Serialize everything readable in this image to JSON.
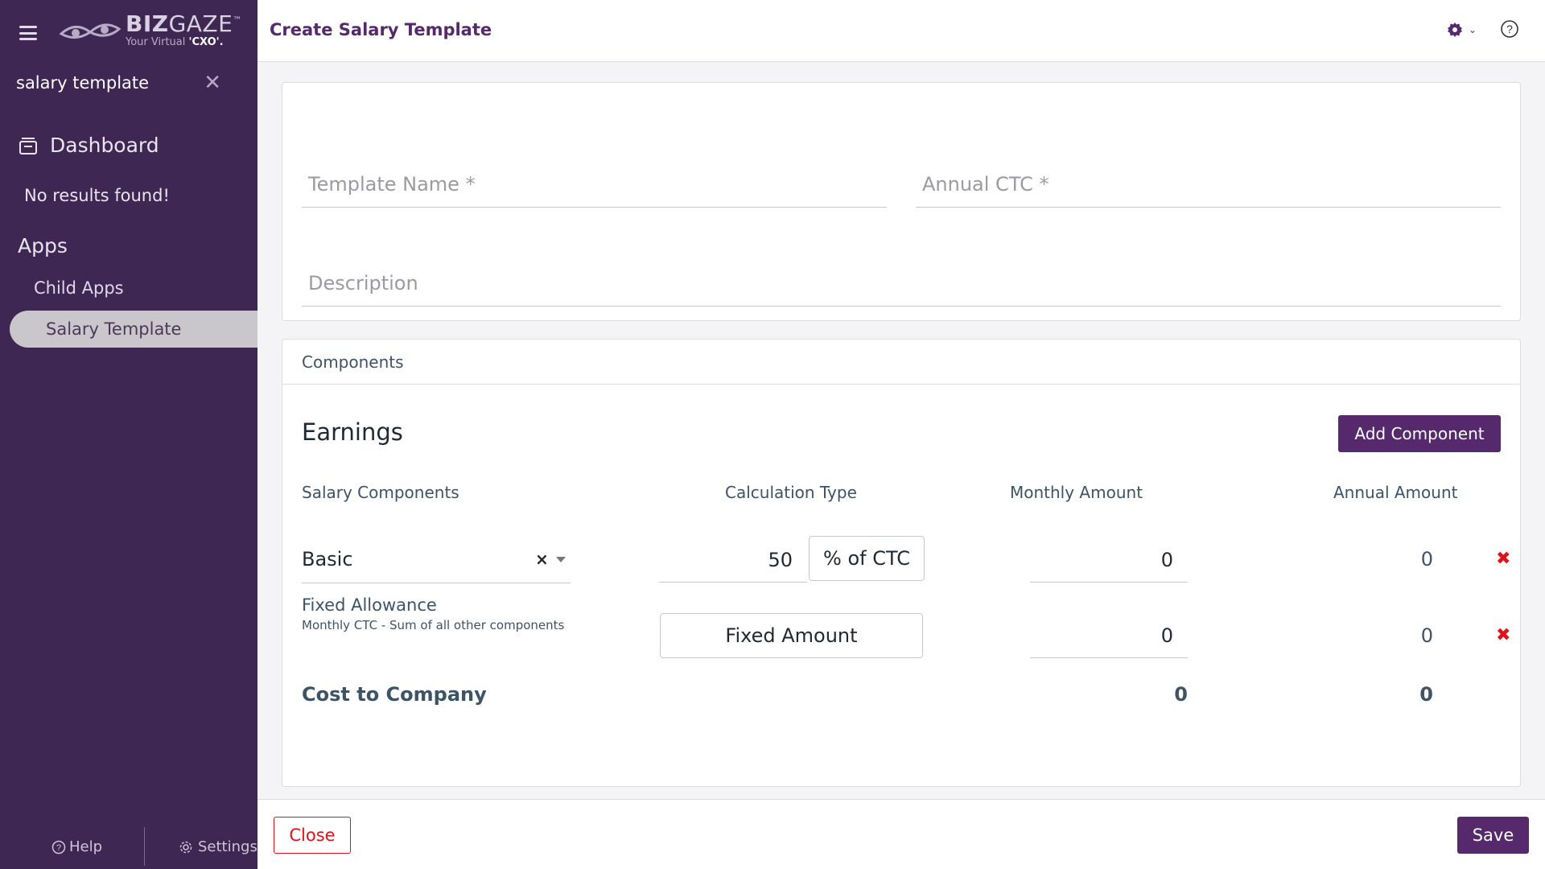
{
  "sidebar": {
    "logo": {
      "brand": "BIZGAZE",
      "brand_bold": "BIZ",
      "brand_light": "GAZE",
      "trademark": "™",
      "tagline_prefix": "Your Virtual ",
      "tagline_bold": "'CXO'."
    },
    "search": {
      "value": "salary template",
      "clear": "✕"
    },
    "dashboard_label": "Dashboard",
    "no_results": "No results found!",
    "apps_label": "Apps",
    "child_apps_label": "Child Apps",
    "active_item": "Salary Template",
    "footer": {
      "help": "Help",
      "settings": "Settings"
    }
  },
  "header": {
    "title": "Create Salary Template"
  },
  "form": {
    "template_name_placeholder": "Template Name *",
    "annual_ctc_placeholder": "Annual CTC *",
    "description_placeholder": "Description"
  },
  "components": {
    "section_title": "Components",
    "earnings_title": "Earnings",
    "add_button": "Add Component",
    "columns": {
      "salary_components": "Salary Components",
      "calculation_type": "Calculation Type",
      "monthly_amount": "Monthly Amount",
      "annual_amount": "Annual Amount"
    },
    "rows": [
      {
        "component": "Basic",
        "clear": "×",
        "percent": "50",
        "calc_type": "% of CTC",
        "monthly": "0",
        "annual": "0",
        "delete": "✖"
      },
      {
        "component": "Fixed Allowance",
        "note": "Monthly CTC - Sum of all other components",
        "calc_type": "Fixed Amount",
        "monthly": "0",
        "annual": "0",
        "delete": "✖"
      }
    ],
    "total": {
      "label": "Cost to Company",
      "monthly": "0",
      "annual": "0"
    }
  },
  "footer": {
    "close": "Close",
    "save": "Save"
  },
  "colors": {
    "sidebar_bg": "#3e2752",
    "brand": "#55296b",
    "danger": "#e0121a",
    "active_item_bg": "#c9c6cc"
  }
}
